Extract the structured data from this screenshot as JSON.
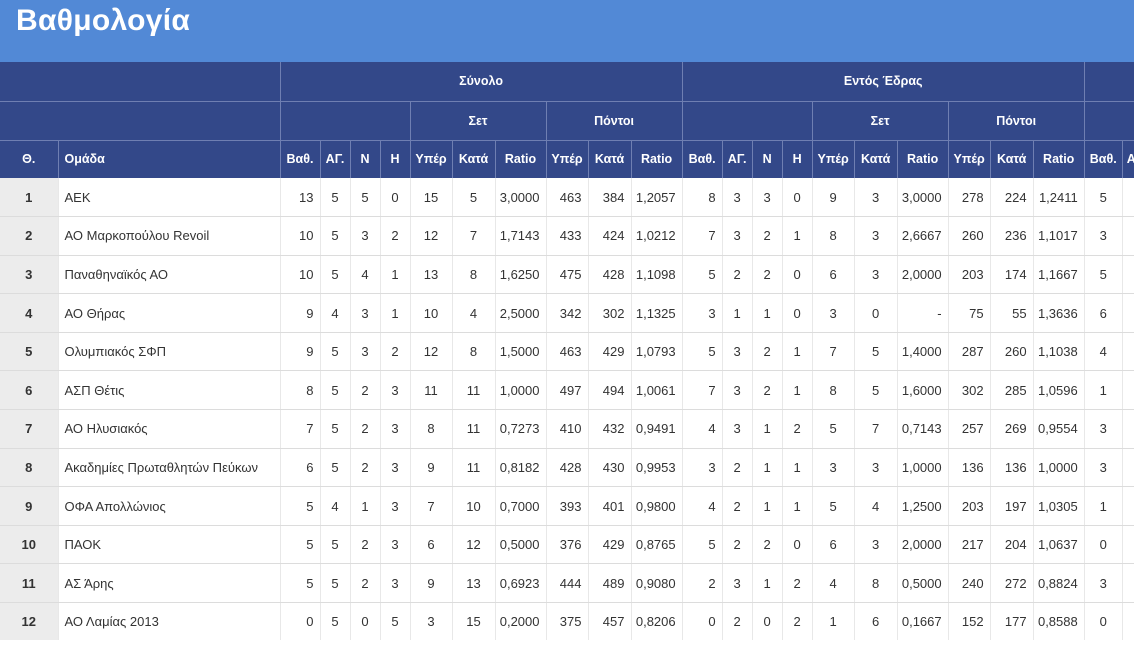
{
  "page": {
    "title": "Βαθμολογία"
  },
  "headers": {
    "group_total": "Σύνολο",
    "group_home": "Εντός Έδρας",
    "sets": "Σετ",
    "points": "Πόντοι",
    "pos": "Θ.",
    "team": "Ομάδα",
    "pts": "Βαθ.",
    "played": "ΑΓ.",
    "won": "Ν",
    "lost": "Η",
    "for": "Υπέρ",
    "against": "Κατά",
    "ratio": "Ratio",
    "extra": "Α"
  },
  "rows": [
    {
      "pos": "1",
      "team": "ΑΕΚ",
      "t": [
        "13",
        "5",
        "5",
        "0",
        "15",
        "5",
        "3,0000",
        "463",
        "384",
        "1,2057"
      ],
      "h": [
        "8",
        "3",
        "3",
        "0",
        "9",
        "3",
        "3,0000",
        "278",
        "224",
        "1,2411"
      ],
      "next": "5"
    },
    {
      "pos": "2",
      "team": "ΑΟ Μαρκοπούλου Revoil",
      "t": [
        "10",
        "5",
        "3",
        "2",
        "12",
        "7",
        "1,7143",
        "433",
        "424",
        "1,0212"
      ],
      "h": [
        "7",
        "3",
        "2",
        "1",
        "8",
        "3",
        "2,6667",
        "260",
        "236",
        "1,1017"
      ],
      "next": "3"
    },
    {
      "pos": "3",
      "team": "Παναθηναϊκός ΑΟ",
      "t": [
        "10",
        "5",
        "4",
        "1",
        "13",
        "8",
        "1,6250",
        "475",
        "428",
        "1,1098"
      ],
      "h": [
        "5",
        "2",
        "2",
        "0",
        "6",
        "3",
        "2,0000",
        "203",
        "174",
        "1,1667"
      ],
      "next": "5"
    },
    {
      "pos": "4",
      "team": "ΑΟ Θήρας",
      "t": [
        "9",
        "4",
        "3",
        "1",
        "10",
        "4",
        "2,5000",
        "342",
        "302",
        "1,1325"
      ],
      "h": [
        "3",
        "1",
        "1",
        "0",
        "3",
        "0",
        "-",
        "75",
        "55",
        "1,3636"
      ],
      "next": "6"
    },
    {
      "pos": "5",
      "team": "Ολυμπιακός ΣΦΠ",
      "t": [
        "9",
        "5",
        "3",
        "2",
        "12",
        "8",
        "1,5000",
        "463",
        "429",
        "1,0793"
      ],
      "h": [
        "5",
        "3",
        "2",
        "1",
        "7",
        "5",
        "1,4000",
        "287",
        "260",
        "1,1038"
      ],
      "next": "4"
    },
    {
      "pos": "6",
      "team": "ΑΣΠ Θέτις",
      "t": [
        "8",
        "5",
        "2",
        "3",
        "11",
        "11",
        "1,0000",
        "497",
        "494",
        "1,0061"
      ],
      "h": [
        "7",
        "3",
        "2",
        "1",
        "8",
        "5",
        "1,6000",
        "302",
        "285",
        "1,0596"
      ],
      "next": "1"
    },
    {
      "pos": "7",
      "team": "ΑΟ Ηλυσιακός",
      "t": [
        "7",
        "5",
        "2",
        "3",
        "8",
        "11",
        "0,7273",
        "410",
        "432",
        "0,9491"
      ],
      "h": [
        "4",
        "3",
        "1",
        "2",
        "5",
        "7",
        "0,7143",
        "257",
        "269",
        "0,9554"
      ],
      "next": "3"
    },
    {
      "pos": "8",
      "team": "Ακαδημίες Πρωταθλητών Πεύκων",
      "t": [
        "6",
        "5",
        "2",
        "3",
        "9",
        "11",
        "0,8182",
        "428",
        "430",
        "0,9953"
      ],
      "h": [
        "3",
        "2",
        "1",
        "1",
        "3",
        "3",
        "1,0000",
        "136",
        "136",
        "1,0000"
      ],
      "next": "3"
    },
    {
      "pos": "9",
      "team": "ΟΦΑ Απολλώνιος",
      "t": [
        "5",
        "4",
        "1",
        "3",
        "7",
        "10",
        "0,7000",
        "393",
        "401",
        "0,9800"
      ],
      "h": [
        "4",
        "2",
        "1",
        "1",
        "5",
        "4",
        "1,2500",
        "203",
        "197",
        "1,0305"
      ],
      "next": "1"
    },
    {
      "pos": "10",
      "team": "ΠΑΟΚ",
      "t": [
        "5",
        "5",
        "2",
        "3",
        "6",
        "12",
        "0,5000",
        "376",
        "429",
        "0,8765"
      ],
      "h": [
        "5",
        "2",
        "2",
        "0",
        "6",
        "3",
        "2,0000",
        "217",
        "204",
        "1,0637"
      ],
      "next": "0"
    },
    {
      "pos": "11",
      "team": "ΑΣ Άρης",
      "t": [
        "5",
        "5",
        "2",
        "3",
        "9",
        "13",
        "0,6923",
        "444",
        "489",
        "0,9080"
      ],
      "h": [
        "2",
        "3",
        "1",
        "2",
        "4",
        "8",
        "0,5000",
        "240",
        "272",
        "0,8824"
      ],
      "next": "3"
    },
    {
      "pos": "12",
      "team": "ΑΟ Λαμίας 2013",
      "t": [
        "0",
        "5",
        "0",
        "5",
        "3",
        "15",
        "0,2000",
        "375",
        "457",
        "0,8206"
      ],
      "h": [
        "0",
        "2",
        "0",
        "2",
        "1",
        "6",
        "0,1667",
        "152",
        "177",
        "0,8588"
      ],
      "next": "0"
    }
  ]
}
